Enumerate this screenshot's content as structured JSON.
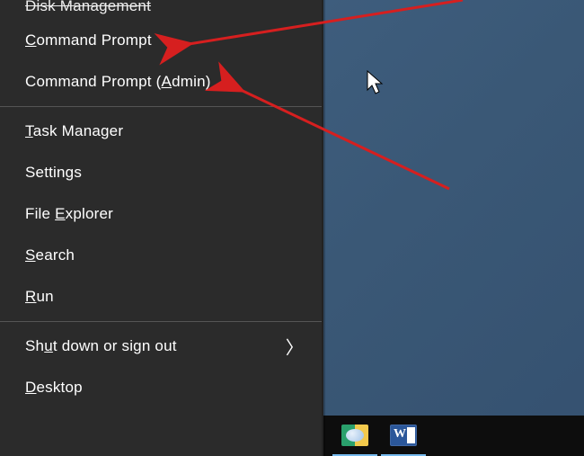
{
  "menu": {
    "items": [
      {
        "pre": "",
        "accel": "",
        "post": "Disk Management",
        "struck": true
      },
      {
        "pre": "",
        "accel": "C",
        "post": "ommand Prompt"
      },
      {
        "pre": "Command Prompt (",
        "accel": "A",
        "post": "dmin)"
      },
      {
        "sep": true
      },
      {
        "pre": "",
        "accel": "T",
        "post": "ask Manager"
      },
      {
        "pre": "Settin",
        "accel": "g",
        "post": "s"
      },
      {
        "pre": "File ",
        "accel": "E",
        "post": "xplorer"
      },
      {
        "pre": "",
        "accel": "S",
        "post": "earch"
      },
      {
        "pre": "",
        "accel": "R",
        "post": "un"
      },
      {
        "sep": true
      },
      {
        "pre": "Sh",
        "accel": "u",
        "post": "t down or sign out",
        "submenu": true
      },
      {
        "pre": "",
        "accel": "D",
        "post": "esktop"
      }
    ]
  },
  "taskbar": {
    "icons": [
      "control-panel-icon",
      "word-icon"
    ]
  },
  "annotation": {
    "arrow_color": "#d61f1f"
  }
}
